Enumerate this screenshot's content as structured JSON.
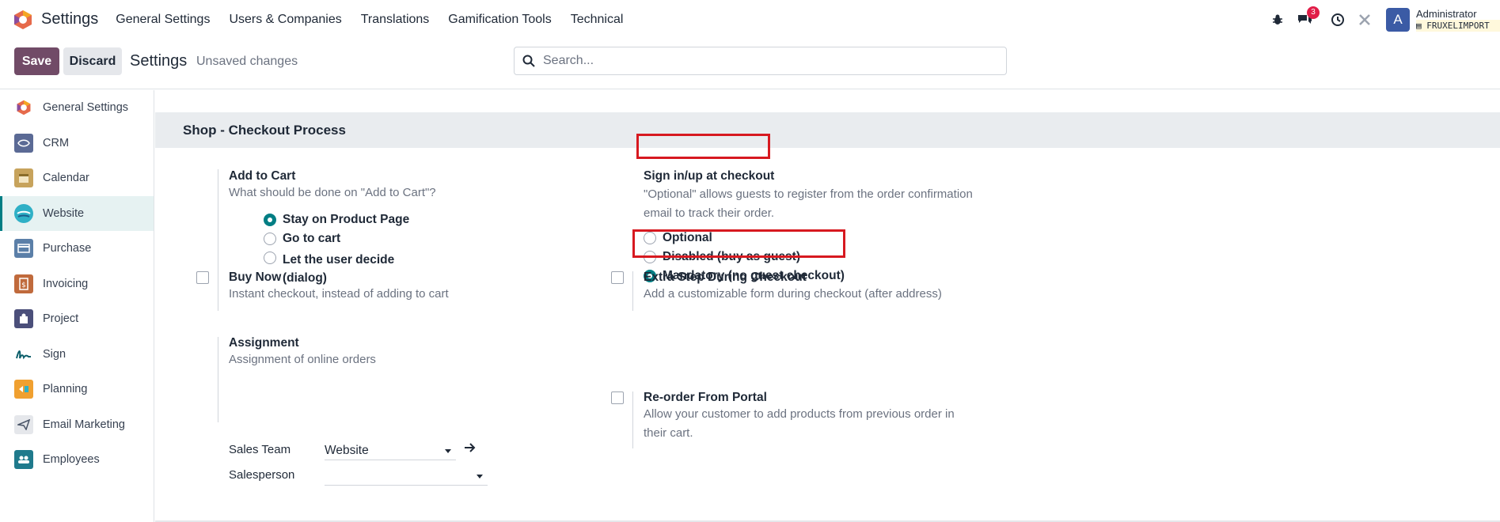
{
  "navbar": {
    "app_name": "Settings",
    "menu": [
      "General Settings",
      "Users & Companies",
      "Translations",
      "Gamification Tools",
      "Technical"
    ],
    "messages_badge": "3",
    "avatar_letter": "A",
    "user_name": "Administrator",
    "db_name": "FRUXELIMPORT"
  },
  "control": {
    "save_label": "Save",
    "discard_label": "Discard",
    "title": "Settings",
    "status": "Unsaved changes",
    "search_placeholder": "Search..."
  },
  "sidebar": {
    "items": [
      {
        "label": "General Settings",
        "icon": "odoo-logo-icon",
        "color": "#e66a4b"
      },
      {
        "label": "CRM",
        "icon": "handshake-icon",
        "color": "#5b6a95"
      },
      {
        "label": "Calendar",
        "icon": "calendar-icon",
        "color": "#c7a35c"
      },
      {
        "label": "Website",
        "icon": "globe-icon",
        "color": "#2fb0c6"
      },
      {
        "label": "Purchase",
        "icon": "card-icon",
        "color": "#5b7fa8"
      },
      {
        "label": "Invoicing",
        "icon": "invoice-icon",
        "color": "#c06a3c"
      },
      {
        "label": "Project",
        "icon": "puzzle-icon",
        "color": "#4b4f7a"
      },
      {
        "label": "Sign",
        "icon": "signature-icon",
        "color": "#0d5f6b"
      },
      {
        "label": "Planning",
        "icon": "planning-icon",
        "color": "#f0a030"
      },
      {
        "label": "Email Marketing",
        "icon": "paper-plane-icon",
        "color": "#4a5568"
      },
      {
        "label": "Employees",
        "icon": "people-icon",
        "color": "#1f7a8c"
      }
    ],
    "active_index": 3
  },
  "section": {
    "title": "Shop - Checkout Process"
  },
  "settings": {
    "add_to_cart": {
      "title": "Add to Cart",
      "desc": "What should be done on \"Add to Cart\"?",
      "options": [
        "Stay on Product Page",
        "Go to cart",
        "Let the user decide",
        "(dialog)"
      ],
      "selected": 0
    },
    "sign_in": {
      "title": "Sign in/up at checkout",
      "desc_line1": "\"Optional\" allows guests to register from the order confirmation",
      "desc_line2": "email to track their order.",
      "options": [
        "Optional",
        "Disabled (buy as guest)",
        "Mandatory (no guest checkout)"
      ],
      "selected": 2
    },
    "buy_now": {
      "title": "Buy Now",
      "desc": "Instant checkout, instead of adding to cart",
      "checked": false
    },
    "extra_step": {
      "title": "Extra Step During Checkout",
      "desc": "Add a customizable form during checkout (after address)",
      "checked": false
    },
    "assignment": {
      "title": "Assignment",
      "desc": "Assignment of online orders",
      "sales_team_label": "Sales Team",
      "sales_team_value": "Website",
      "salesperson_label": "Salesperson",
      "salesperson_value": ""
    },
    "reorder": {
      "title": "Re-order From Portal",
      "desc_line1": "Allow your customer to add products from previous order in",
      "desc_line2": "their cart.",
      "checked": false
    }
  },
  "highlight_color": "#d71920"
}
